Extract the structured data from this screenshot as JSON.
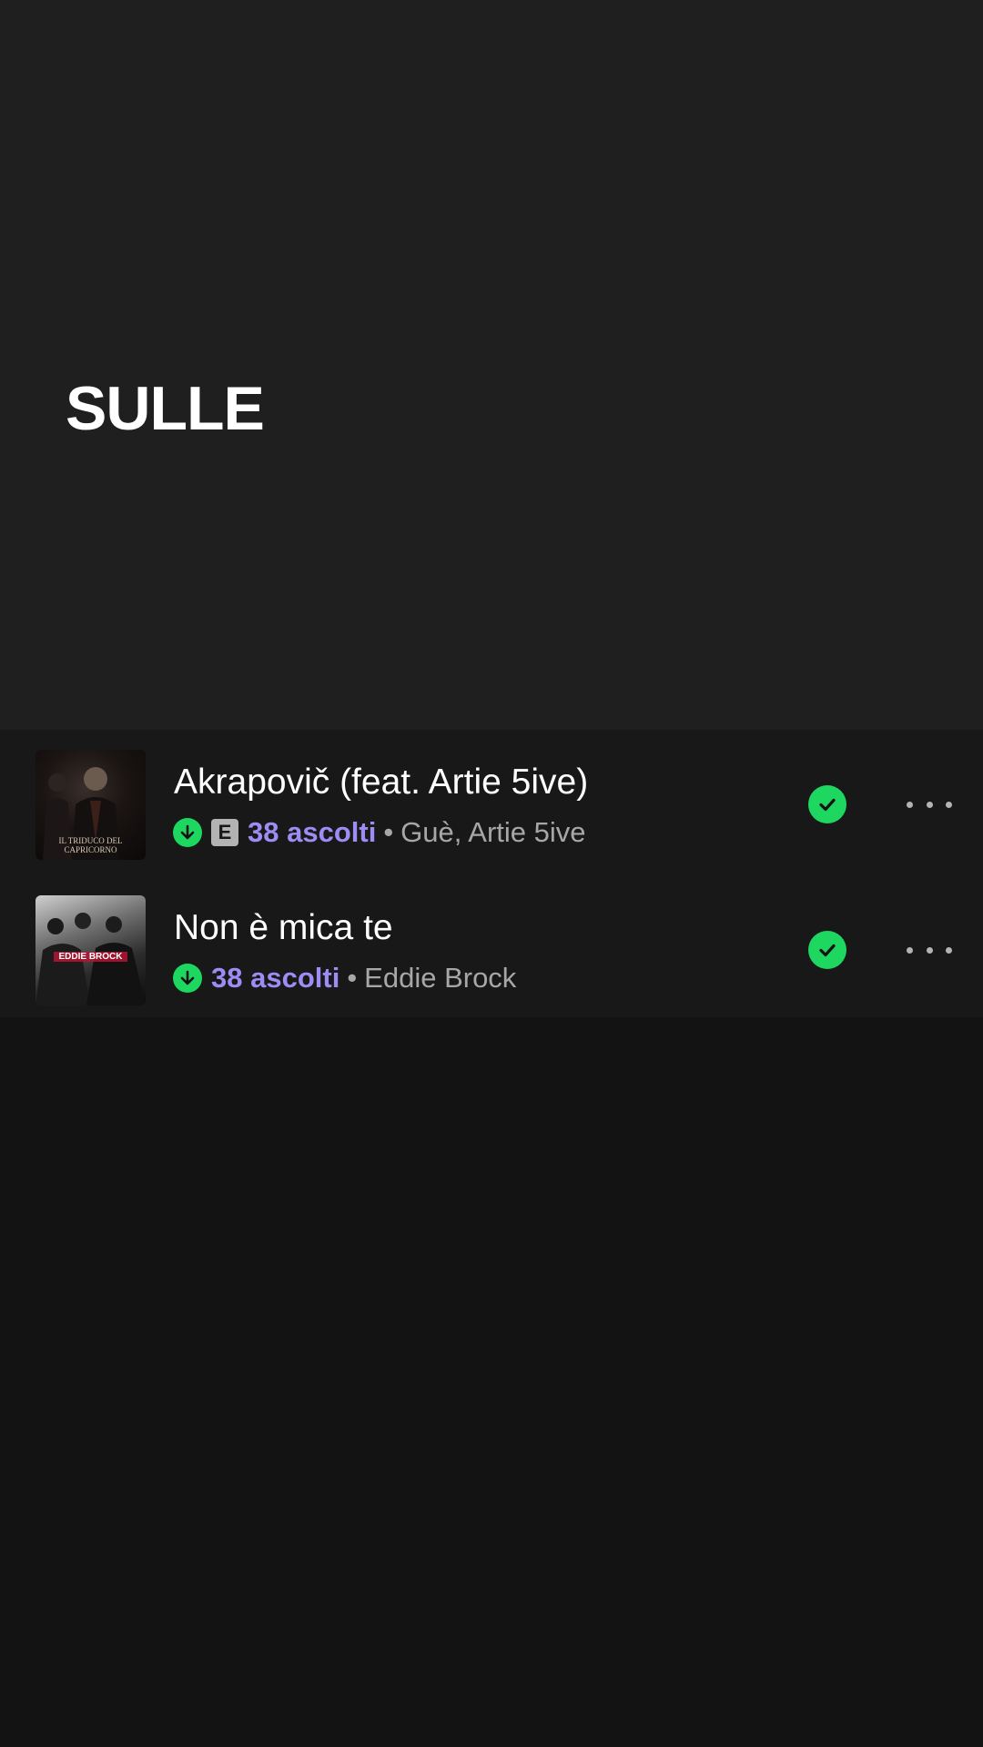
{
  "header": {
    "title": "SULLE"
  },
  "tracks": [
    {
      "title": "Akrapovič (feat. Artie 5ive)",
      "explicit_label": "E",
      "plays": "38 ascolti",
      "separator": "•",
      "artists": "Guè, Artie 5ive",
      "cover_text": "IL TRIDUCO DEL CAPRICORNO",
      "downloaded": true,
      "liked": true
    },
    {
      "title": "Non è mica te",
      "plays": "38 ascolti",
      "separator": "•",
      "artists": "Eddie Brock",
      "cover_text": "EDDIE BROCK",
      "downloaded": true,
      "liked": true
    }
  ],
  "colors": {
    "accent_green": "#1ed760",
    "plays_purple": "#9e8cf5",
    "header_bg": "#1f1f1f",
    "list_bg": "#181818",
    "page_bg": "#131313"
  },
  "icons": {
    "download": "download-arrow-icon",
    "liked": "check-circle-icon",
    "more": "more-horizontal-icon"
  }
}
